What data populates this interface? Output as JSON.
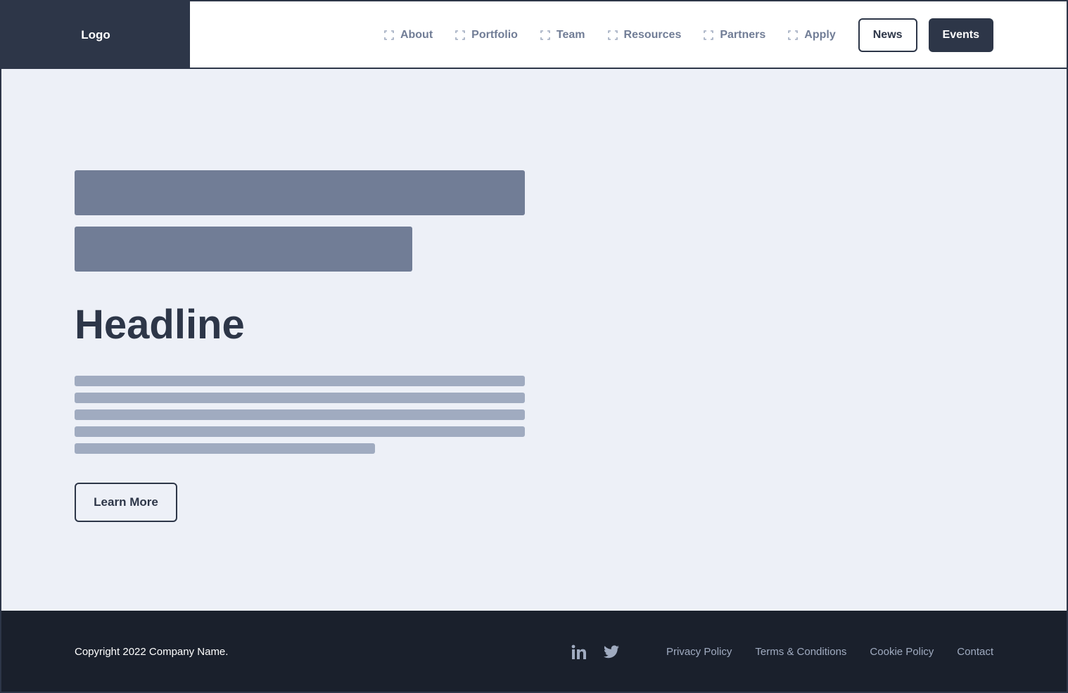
{
  "header": {
    "logo": "Logo",
    "nav": [
      {
        "label": "About",
        "icon": "focus-bracket-icon"
      },
      {
        "label": "Portfolio",
        "icon": "focus-bracket-icon"
      },
      {
        "label": "Team",
        "icon": "focus-bracket-icon"
      },
      {
        "label": "Resources",
        "icon": "focus-bracket-icon"
      },
      {
        "label": "Partners",
        "icon": "focus-bracket-icon"
      },
      {
        "label": "Apply",
        "icon": "focus-bracket-icon"
      }
    ],
    "news_label": "News",
    "events_label": "Events"
  },
  "hero": {
    "headline": "Headline",
    "cta_label": "Learn More"
  },
  "footer": {
    "copyright": "Copyright 2022 Company Name.",
    "social": [
      "linkedin-icon",
      "twitter-icon"
    ],
    "links": [
      "Privacy Policy",
      "Terms & Conditions",
      "Cookie Policy",
      "Contact"
    ]
  },
  "colors": {
    "primary": "#2d3648",
    "muted": "#717d96",
    "light": "#a0abc0",
    "background": "#edf0f7",
    "footer": "#1a202c"
  }
}
